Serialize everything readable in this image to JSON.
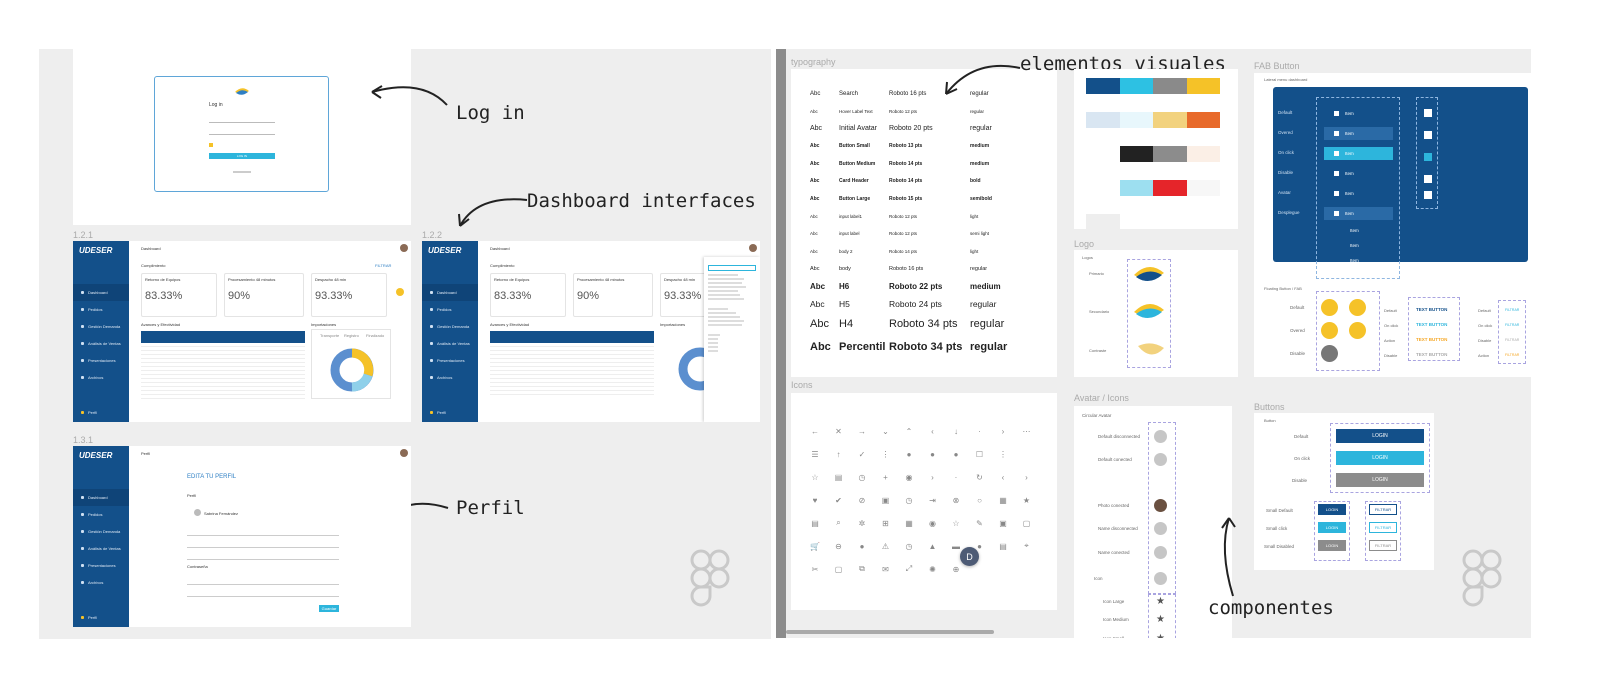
{
  "annotations": {
    "login": "Log in",
    "dashboard": "Dashboard interfaces",
    "perfil": "Perfil",
    "visuales": "elementos visuales",
    "componentes": "componentes"
  },
  "frames": {
    "f121": "1.2.1",
    "f122": "1.2.2",
    "f131": "1.3.1",
    "typography": "typography",
    "icons": "Icons",
    "logo": "Logo",
    "avatar": "Avatar / Icons",
    "fab": "FAB Button",
    "buttons": "Buttons"
  },
  "login": {
    "title": "Log in",
    "button": "LOG IN"
  },
  "dashboard": {
    "brand": "UDESER",
    "header": "Dashboard",
    "section": "Cumplimiento",
    "filter": "FILTRAR",
    "kpis": [
      {
        "label": "Retorno de Equipos",
        "value": "83.33%"
      },
      {
        "label": "Procesamiento 48 minutos",
        "value": "90%"
      },
      {
        "label": "Despacho 48 min",
        "value": "93.33%"
      }
    ],
    "sub1": "Avances y Efectividad",
    "sub2": "Importaciones",
    "legend": [
      "Transporte",
      "Registro",
      "Finalizado"
    ],
    "nav": [
      "Dashboard",
      "Pedidos",
      "Gestión Demanda",
      "Análisis de Ventas",
      "Presentaciones",
      "Archivos",
      "Perfil"
    ]
  },
  "perfil": {
    "header": "Perfil",
    "title": "EDITA TU PERFIL",
    "section1": "Perfil",
    "name": "Sabrina Fernández",
    "section2": "Contraseña",
    "save": "Guardar"
  },
  "typography": {
    "rows": [
      {
        "a": "Abc",
        "b": "Search",
        "c": "Roboto 16 pts",
        "d": "regular",
        "w": "400",
        "s": "6"
      },
      {
        "a": "Abc",
        "b": "Hover Label Text",
        "c": "Roboto 12 pts",
        "d": "regular",
        "w": "400",
        "s": "4.5"
      },
      {
        "a": "Abc",
        "b": "Initial Avatar",
        "c": "Roboto 20 pts",
        "d": "regular",
        "w": "400",
        "s": "7"
      },
      {
        "a": "Abc",
        "b": "Button Small",
        "c": "Roboto 13 pts",
        "d": "medium",
        "w": "700",
        "s": "5"
      },
      {
        "a": "Abc",
        "b": "Button Medium",
        "c": "Roboto 14 pts",
        "d": "medium",
        "w": "700",
        "s": "5"
      },
      {
        "a": "Abc",
        "b": "Card Header",
        "c": "Roboto 14 pts",
        "d": "bold",
        "w": "700",
        "s": "5"
      },
      {
        "a": "Abc",
        "b": "Button Large",
        "c": "Roboto 15 pts",
        "d": "semibold",
        "w": "700",
        "s": "5"
      },
      {
        "a": "Abc",
        "b": "input label1",
        "c": "Roboto 12 pts",
        "d": "light",
        "w": "400",
        "s": "4.5"
      },
      {
        "a": "Abc",
        "b": "input label",
        "c": "Roboto 12 pts",
        "d": "semi light",
        "w": "400",
        "s": "4.5"
      },
      {
        "a": "Abc",
        "b": "body 2",
        "c": "Roboto 14 pts",
        "d": "light",
        "w": "400",
        "s": "4.5"
      },
      {
        "a": "Abc",
        "b": "body",
        "c": "Roboto 16 pts",
        "d": "regular",
        "w": "400",
        "s": "5.5"
      },
      {
        "a": "Abc",
        "b": "H6",
        "c": "Roboto 22 pts",
        "d": "medium",
        "w": "700",
        "s": "8"
      },
      {
        "a": "Abc",
        "b": "H5",
        "c": "Roboto 24 pts",
        "d": "regular",
        "w": "400",
        "s": "8.5"
      },
      {
        "a": "Abc",
        "b": "H4",
        "c": "Roboto 34 pts",
        "d": "regular",
        "w": "400",
        "s": "11"
      },
      {
        "a": "Abc",
        "b": "Percentil",
        "c": "Roboto 34 pts",
        "d": "regular",
        "w": "700",
        "s": "11"
      }
    ]
  },
  "colors": {
    "row1": [
      "#13508a",
      "#2dc1e3",
      "#8a8a8a",
      "#f5c228"
    ],
    "row2": [
      "#d9e6f2",
      "#e8f7fc",
      "#f2d27e",
      "#e86a2a"
    ],
    "row3": [
      "#ffffff",
      "#222222",
      "#8c8c8c",
      "#fbefe6"
    ],
    "row4": [
      "#ffffff",
      "#9ddff0",
      "#e5252a",
      "#f7f7f7"
    ],
    "row5": [
      "#eeeeee"
    ]
  },
  "logo": {
    "label": "Logos",
    "items": [
      "Primario",
      "Secundario",
      "Contraste"
    ]
  },
  "avatar": {
    "title": "Circular Avatar",
    "items": [
      "Default disconnected",
      "Default conected",
      "Photo conected",
      "Name disconnected",
      "Name conected",
      "Icon",
      "Icon Large",
      "Icon Medium",
      "Icon Small"
    ],
    "initial": "D"
  },
  "fab": {
    "subtitle": "Lateral menu dashboard",
    "states": [
      "Default",
      "Overed",
      "On click",
      "Disable",
      "Avatar",
      "Desplegue"
    ],
    "item": "Item",
    "fab_title": "Floating Button / FAB",
    "fab_states": [
      "Default",
      "Overed",
      "Disable"
    ],
    "text_states": [
      "Default",
      "On click",
      "Action",
      "Disable"
    ],
    "text_button": "TEXT BUTTON",
    "states2": [
      "Default",
      "On click",
      "Disable",
      "Action"
    ],
    "mini": "FILTRAR"
  },
  "buttons": {
    "label": "Button",
    "rows": [
      "Default",
      "On click",
      "Disable"
    ],
    "login": "LOGIN",
    "small": [
      "Small Default",
      "Small click",
      "Small Disabled"
    ],
    "filter": "FILTRAR"
  },
  "icons": [
    "←",
    "✕",
    "→",
    "⌄",
    "⌃",
    "‹",
    "↓",
    "·",
    "›",
    "⋯",
    "☰",
    "↑",
    "✓",
    "⋮",
    "●",
    "●",
    "●",
    "☐",
    "⋮",
    "",
    "☆",
    "▤",
    "◷",
    "+",
    "◉",
    "›",
    "·",
    "↻",
    "‹",
    "›",
    "♥",
    "✔",
    "⊘",
    "▣",
    "◷",
    "⇥",
    "⊗",
    "○",
    "▦",
    "★",
    "▤",
    "⌕",
    "✲",
    "⊞",
    "▦",
    "◉",
    "☆",
    "✎",
    "▣",
    "▢",
    "🛒",
    "⊖",
    "●",
    "⚠",
    "◷",
    "▲",
    "▬",
    "●",
    "▤",
    "⌖",
    "✂",
    "▢",
    "⧉",
    "✉",
    "⤢",
    "✺",
    "⊕"
  ]
}
